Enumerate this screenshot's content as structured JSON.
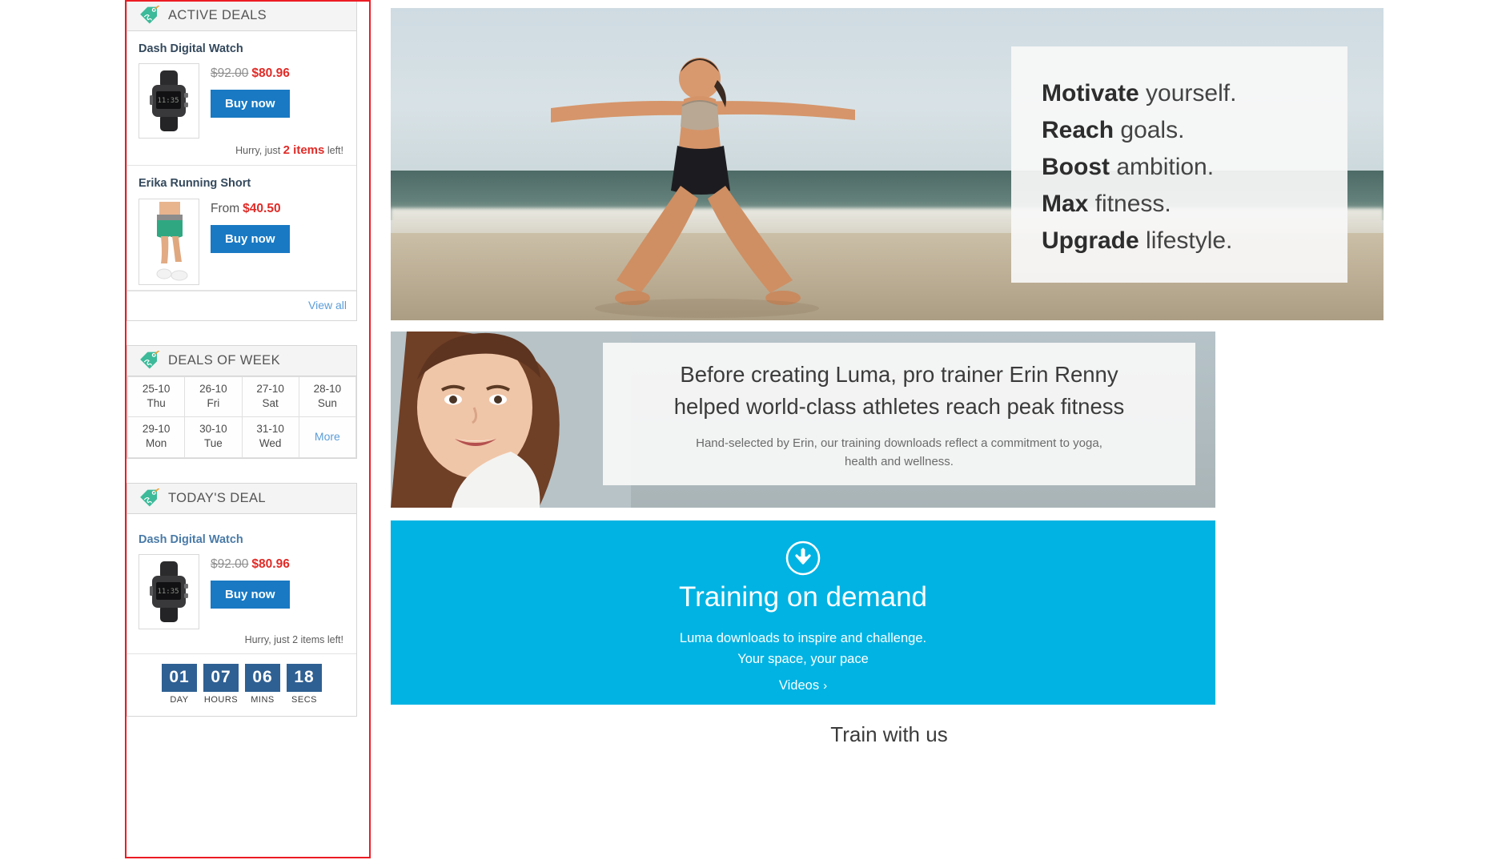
{
  "sidebar": {
    "active_deals": {
      "title": "ACTIVE DEALS",
      "icon": "price-tag-icon",
      "items": [
        {
          "name": "Dash Digital Watch",
          "old_price": "$92.00",
          "new_price": "$80.96",
          "from_label": "",
          "buy_label": "Buy now",
          "stock_prefix": "Hurry, just",
          "stock_count": "2 items",
          "stock_suffix": "left!",
          "thumb": "digital-watch-photo"
        },
        {
          "name": "Erika Running Short",
          "old_price": "",
          "new_price": "$40.50",
          "from_label": "From",
          "buy_label": "Buy now",
          "stock_prefix": "",
          "stock_count": "",
          "stock_suffix": "",
          "thumb": "running-short-photo"
        }
      ],
      "view_all_label": "View all"
    },
    "deals_of_week": {
      "title": "DEALS OF WEEK",
      "icon": "price-tag-icon",
      "days": [
        {
          "date": "25-10",
          "day": "Thu"
        },
        {
          "date": "26-10",
          "day": "Fri"
        },
        {
          "date": "27-10",
          "day": "Sat"
        },
        {
          "date": "28-10",
          "day": "Sun"
        },
        {
          "date": "29-10",
          "day": "Mon"
        },
        {
          "date": "30-10",
          "day": "Tue"
        },
        {
          "date": "31-10",
          "day": "Wed"
        }
      ],
      "more_label": "More"
    },
    "todays_deal": {
      "title": "TODAY'S DEAL",
      "icon": "price-tag-icon",
      "product_name": "Dash Digital Watch",
      "old_price": "$92.00",
      "new_price": "$80.96",
      "buy_label": "Buy now",
      "stock_text": "Hurry, just 2 items left!",
      "countdown": [
        {
          "value": "01",
          "label": "DAY"
        },
        {
          "value": "07",
          "label": "HOURS"
        },
        {
          "value": "06",
          "label": "MINS"
        },
        {
          "value": "18",
          "label": "SECS"
        }
      ]
    }
  },
  "main": {
    "hero": {
      "lines": [
        {
          "strong": "Motivate",
          "rest": " yourself."
        },
        {
          "strong": "Reach",
          "rest": " goals."
        },
        {
          "strong": "Boost",
          "rest": " ambition."
        },
        {
          "strong": "Max",
          "rest": " fitness."
        },
        {
          "strong": "Upgrade",
          "rest": " lifestyle."
        }
      ]
    },
    "promo_trainer": {
      "heading_line1": "Before creating Luma, pro trainer Erin Renny",
      "heading_line2": "helped world-class athletes reach peak fitness",
      "sub_line1": "Hand-selected by Erin, our training downloads reflect a commitment to yoga,",
      "sub_line2": "health and wellness."
    },
    "promo_training": {
      "icon": "download-circle-icon",
      "heading": "Training on demand",
      "body_line1": "Luma downloads to inspire and challenge.",
      "body_line2": "Your space, your pace",
      "link_label": "Videos",
      "link_chevron": "›"
    },
    "below_fold_text": "Train with us"
  },
  "colors": {
    "accent_blue": "#1979c3",
    "cyan_banner": "#00b3e3",
    "price_red": "#e02b27",
    "countdown_blue": "#2f6093",
    "highlight_red": "#ec1c24",
    "tag_green": "#3cba99"
  }
}
